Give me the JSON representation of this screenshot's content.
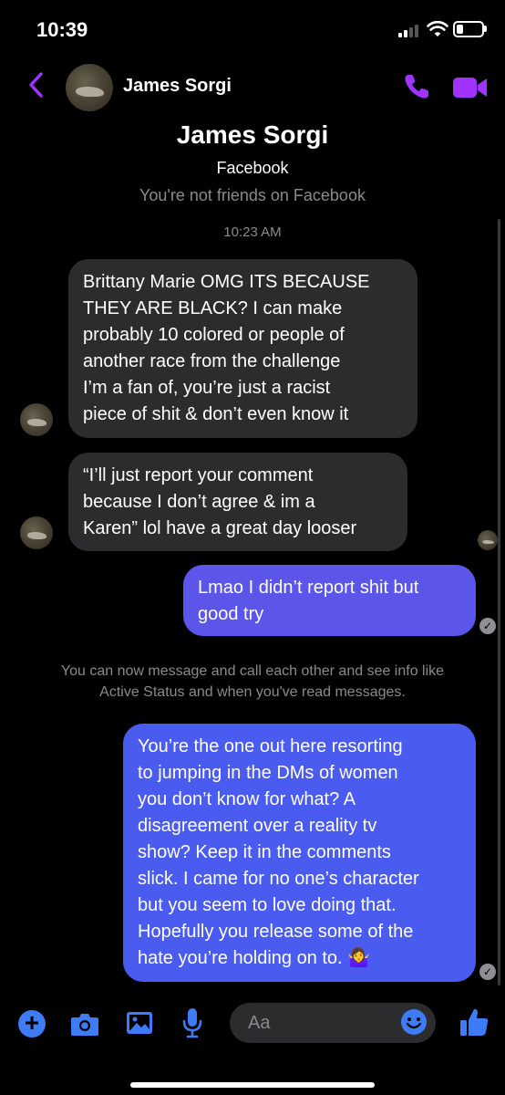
{
  "status_bar": {
    "time": "10:39"
  },
  "header": {
    "contact_name": "James Sorgi"
  },
  "profile": {
    "name": "James Sorgi",
    "platform": "Facebook",
    "friend_status": "You're not friends on Facebook",
    "timestamp": "10:23 AM"
  },
  "messages": [
    {
      "direction": "incoming",
      "lines": [
        "Brittany Marie OMG ITS BECAUSE",
        "THEY ARE BLACK? I can make",
        "probably 10 colored or people of",
        "another race from the challenge",
        "I’m a fan of, you’re just a racist",
        "piece of shit & don’t even know it"
      ]
    },
    {
      "direction": "incoming",
      "lines": [
        "“I’ll just report your comment",
        "because I don’t agree & im a",
        "Karen” lol have a great day looser"
      ]
    },
    {
      "direction": "outgoing",
      "lines": [
        "Lmao I didn’t report shit but",
        "good try"
      ]
    },
    {
      "direction": "outgoing",
      "lines": [
        "You’re the one out here resorting",
        "to jumping in the DMs of women",
        "you don’t know for what? A",
        "disagreement over a reality tv",
        "show? Keep it in the comments",
        "slick. I came for no one’s character",
        "but you seem to love doing that.",
        "Hopefully you release some of the",
        "hate you’re holding on to. 🤷‍♀️"
      ]
    }
  ],
  "system_message": {
    "line1": "You can now message and call each other and see info like",
    "line2": "Active Status and when you've read messages."
  },
  "composer": {
    "placeholder": "Aa"
  },
  "colors": {
    "accent": "#a033ff",
    "bubble_out": "#4a5bf0",
    "bubble_in": "#2c2c2e",
    "composer_icons": "#3d7cf6"
  }
}
